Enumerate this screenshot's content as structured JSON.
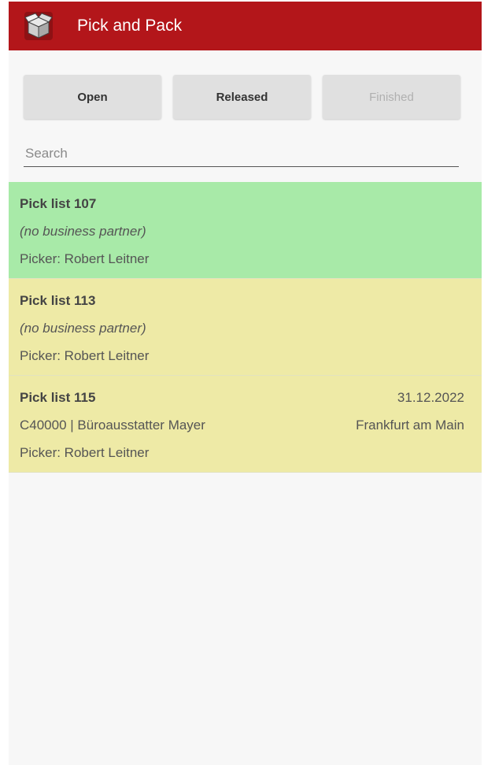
{
  "app": {
    "title": "Pick and Pack",
    "icon": "open-box-icon",
    "header_color": "#b3161a"
  },
  "tabs": [
    {
      "label": "Open",
      "enabled": true
    },
    {
      "label": "Released",
      "enabled": true
    },
    {
      "label": "Finished",
      "enabled": false
    }
  ],
  "search": {
    "placeholder": "Search",
    "value": ""
  },
  "pick_lists": [
    {
      "title": "Pick list 107",
      "partner": "(no business partner)",
      "picker": "Picker: Robert Leitner",
      "date": "",
      "city": "",
      "color": "#a8eaa8"
    },
    {
      "title": "Pick list 113",
      "partner": "(no business partner)",
      "picker": "Picker: Robert Leitner",
      "date": "",
      "city": "",
      "color": "#eeeaa6"
    },
    {
      "title": "Pick list 115",
      "partner": "C40000 | Büroausstatter Mayer",
      "picker": "Picker: Robert Leitner",
      "date": "31.12.2022",
      "city": "Frankfurt am Main",
      "color": "#eeeaa6"
    }
  ]
}
